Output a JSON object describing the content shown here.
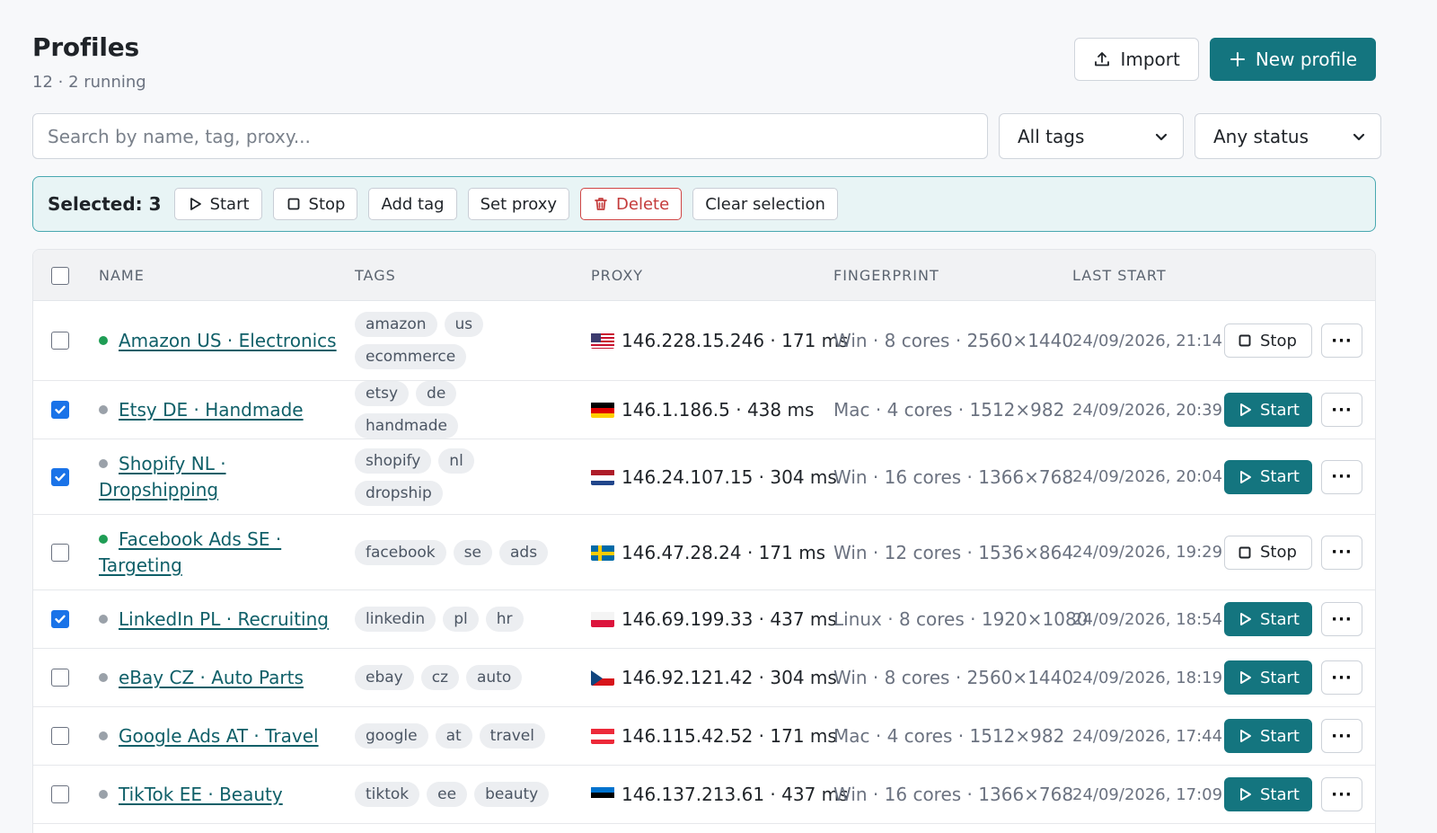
{
  "header": {
    "title": "Profiles",
    "subtitle": "12 · 2 running",
    "import_label": "Import",
    "new_profile_label": "New profile"
  },
  "filters": {
    "search_placeholder": "Search by name, tag, proxy...",
    "tags_selected": "All tags",
    "status_selected": "Any status"
  },
  "bulk": {
    "selected_label": "Selected: 3",
    "start_label": "Start",
    "stop_label": "Stop",
    "add_tag_label": "Add tag",
    "set_proxy_label": "Set proxy",
    "delete_label": "Delete",
    "clear_label": "Clear selection"
  },
  "table": {
    "headers": {
      "name": "NAME",
      "tags": "TAGS",
      "proxy": "PROXY",
      "fingerprint": "FINGERPRINT",
      "last_start": "LAST START"
    },
    "rows": [
      {
        "name": "Amazon US · Electronics",
        "running": true,
        "checked": false,
        "tags": [
          "amazon",
          "us",
          "ecommerce"
        ],
        "flag": "us",
        "proxy": "146.228.15.246 · 171 ms",
        "fingerprint": "Win · 8 cores · 2560×1440",
        "last_start": "24/09/2026, 21:14",
        "action": "Stop"
      },
      {
        "name": "Etsy DE · Handmade",
        "running": false,
        "checked": true,
        "tags": [
          "etsy",
          "de",
          "handmade"
        ],
        "flag": "de",
        "proxy": "146.1.186.5 · 438 ms",
        "fingerprint": "Mac · 4 cores · 1512×982",
        "last_start": "24/09/2026, 20:39",
        "action": "Start"
      },
      {
        "name": "Shopify NL · Dropshipping",
        "running": false,
        "checked": true,
        "tags": [
          "shopify",
          "nl",
          "dropship"
        ],
        "flag": "nl",
        "proxy": "146.24.107.15 · 304 ms",
        "fingerprint": "Win · 16 cores · 1366×768",
        "last_start": "24/09/2026, 20:04",
        "action": "Start"
      },
      {
        "name": "Facebook Ads SE · Targeting",
        "running": true,
        "checked": false,
        "tags": [
          "facebook",
          "se",
          "ads"
        ],
        "flag": "se",
        "proxy": "146.47.28.24 · 171 ms",
        "fingerprint": "Win · 12 cores · 1536×864",
        "last_start": "24/09/2026, 19:29",
        "action": "Stop"
      },
      {
        "name": "LinkedIn PL · Recruiting",
        "running": false,
        "checked": true,
        "tags": [
          "linkedin",
          "pl",
          "hr"
        ],
        "flag": "pl",
        "proxy": "146.69.199.33 · 437 ms",
        "fingerprint": "Linux · 8 cores · 1920×1080",
        "last_start": "24/09/2026, 18:54",
        "action": "Start"
      },
      {
        "name": "eBay CZ · Auto Parts",
        "running": false,
        "checked": false,
        "tags": [
          "ebay",
          "cz",
          "auto"
        ],
        "flag": "cz",
        "proxy": "146.92.121.42 · 304 ms",
        "fingerprint": "Win · 8 cores · 2560×1440",
        "last_start": "24/09/2026, 18:19",
        "action": "Start"
      },
      {
        "name": "Google Ads AT · Travel",
        "running": false,
        "checked": false,
        "tags": [
          "google",
          "at",
          "travel"
        ],
        "flag": "at",
        "proxy": "146.115.42.52 · 171 ms",
        "fingerprint": "Mac · 4 cores · 1512×982",
        "last_start": "24/09/2026, 17:44",
        "action": "Start"
      },
      {
        "name": "TikTok EE · Beauty",
        "running": false,
        "checked": false,
        "tags": [
          "tiktok",
          "ee",
          "beauty"
        ],
        "flag": "ee",
        "proxy": "146.137.213.61 · 437 ms",
        "fingerprint": "Win · 16 cores · 1366×768",
        "last_start": "24/09/2026, 17:09",
        "action": "Start"
      }
    ],
    "more_label": "···"
  },
  "colors": {
    "accent": "#14757f",
    "running_dot": "#1f9d55",
    "idle_dot": "#9aa1a9",
    "danger": "#d04545",
    "checkbox": "#1a73e8"
  }
}
